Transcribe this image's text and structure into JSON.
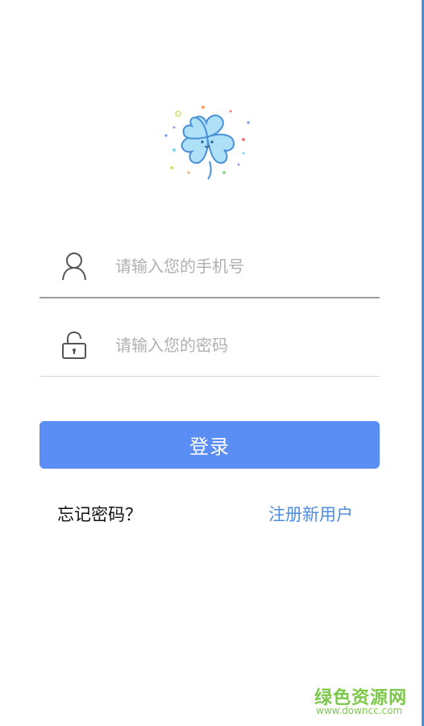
{
  "colors": {
    "primary": "#5b8ef5",
    "link": "#4e8de0",
    "placeholder": "#b0b0b0",
    "logo_fill": "#aee0f8",
    "logo_stroke": "#4a90d9",
    "watermark": "#7cc94a"
  },
  "logo": {
    "icon": "clover-mascot-icon"
  },
  "login_form": {
    "phone_field": {
      "icon": "user-icon",
      "placeholder": "请输入您的手机号",
      "value": ""
    },
    "password_field": {
      "icon": "lock-icon",
      "placeholder": "请输入您的密码",
      "value": ""
    },
    "login_button_label": "登录"
  },
  "links": {
    "forgot_password": "忘记密码？",
    "register": "注册新用户"
  },
  "watermark": {
    "title": "绿色资源网",
    "url": "www.downcc.com"
  }
}
